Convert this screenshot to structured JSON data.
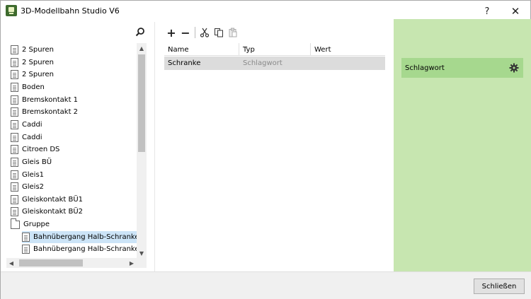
{
  "window": {
    "title": "3D-Modellbahn Studio V6",
    "help_label": "?",
    "close_glyph": "✕"
  },
  "tree": {
    "items": [
      {
        "label": "2 Spuren",
        "icon": "document-icon",
        "level": 0,
        "selected": false
      },
      {
        "label": "2 Spuren",
        "icon": "document-icon",
        "level": 0,
        "selected": false
      },
      {
        "label": "2 Spuren",
        "icon": "document-icon",
        "level": 0,
        "selected": false
      },
      {
        "label": "Boden",
        "icon": "document-icon",
        "level": 0,
        "selected": false
      },
      {
        "label": "Bremskontakt 1",
        "icon": "document-icon",
        "level": 0,
        "selected": false
      },
      {
        "label": "Bremskontakt 2",
        "icon": "document-icon",
        "level": 0,
        "selected": false
      },
      {
        "label": "Caddi",
        "icon": "document-icon",
        "level": 0,
        "selected": false
      },
      {
        "label": "Caddi",
        "icon": "document-icon",
        "level": 0,
        "selected": false
      },
      {
        "label": "Citroen DS",
        "icon": "document-icon",
        "level": 0,
        "selected": false
      },
      {
        "label": "Gleis BÜ",
        "icon": "document-icon",
        "level": 0,
        "selected": false
      },
      {
        "label": "Gleis1",
        "icon": "document-icon",
        "level": 0,
        "selected": false
      },
      {
        "label": "Gleis2",
        "icon": "document-icon",
        "level": 0,
        "selected": false
      },
      {
        "label": "Gleiskontakt BÜ1",
        "icon": "document-icon",
        "level": 0,
        "selected": false
      },
      {
        "label": "Gleiskontakt BÜ2",
        "icon": "document-icon",
        "level": 0,
        "selected": false
      },
      {
        "label": "Gruppe",
        "icon": "folder-icon",
        "level": 0,
        "selected": false
      },
      {
        "label": "Bahnübergang Halb-Schranke",
        "icon": "document-icon",
        "level": 1,
        "selected": true
      },
      {
        "label": "Bahnübergang Halb-Schranke",
        "icon": "document-icon",
        "level": 1,
        "selected": false
      }
    ]
  },
  "toolbar": {
    "add_glyph": "+",
    "remove_glyph": "−"
  },
  "table": {
    "columns": [
      "Name",
      "Typ",
      "Wert"
    ],
    "rows": [
      {
        "name": "Schranke",
        "typ": "Schlagwort",
        "wert": ""
      }
    ]
  },
  "keyword_panel": {
    "label": "Schlagwort"
  },
  "footer": {
    "close_label": "Schließen"
  },
  "colors": {
    "right_panel_bg": "#c7e6b0",
    "keyword_bar_bg": "#a6d88e",
    "selected_item_bg": "#cce4f7",
    "selected_row_bg": "#dcdcdc"
  }
}
